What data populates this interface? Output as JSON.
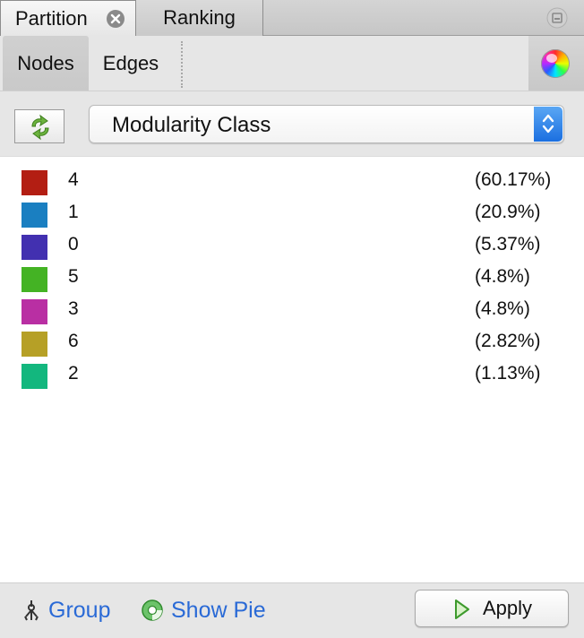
{
  "tabs": [
    {
      "label": "Partition",
      "active": true
    },
    {
      "label": "Ranking",
      "active": false
    }
  ],
  "subtabs": [
    {
      "label": "Nodes",
      "active": true
    },
    {
      "label": "Edges",
      "active": false
    }
  ],
  "dropdown": {
    "selected": "Modularity Class"
  },
  "partitions": [
    {
      "label": "4",
      "percent": "(60.17%)",
      "color": "#b31e13"
    },
    {
      "label": "1",
      "percent": "(20.9%)",
      "color": "#1a7fc1"
    },
    {
      "label": "0",
      "percent": "(5.37%)",
      "color": "#4230b0"
    },
    {
      "label": "5",
      "percent": "(4.8%)",
      "color": "#44b324"
    },
    {
      "label": "3",
      "percent": "(4.8%)",
      "color": "#b92fa3"
    },
    {
      "label": "6",
      "percent": "(2.82%)",
      "color": "#b6a026"
    },
    {
      "label": "2",
      "percent": "(1.13%)",
      "color": "#13b77e"
    }
  ],
  "footer": {
    "group_label": "Group",
    "show_pie_label": "Show Pie",
    "apply_label": "Apply"
  },
  "icons": {
    "close": "close-icon",
    "minimize": "minimize-icon",
    "color_wheel": "color-wheel-icon",
    "refresh": "refresh-icon",
    "dropdown_arrows": "chevron-updown-icon",
    "group": "group-icon",
    "pie": "pie-icon",
    "apply": "play-icon"
  },
  "colors": {
    "link": "#2a6ad6",
    "accent": "#1b6fe0"
  }
}
